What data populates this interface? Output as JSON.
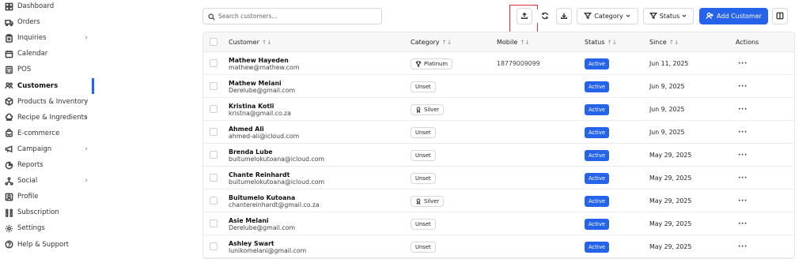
{
  "sidebar": {
    "items": [
      {
        "label": "Dashboard",
        "icon": "dashboard-icon",
        "chevron": false
      },
      {
        "label": "Orders",
        "icon": "truck-icon",
        "chevron": false
      },
      {
        "label": "Inquiries",
        "icon": "clipboard-icon",
        "chevron": true
      },
      {
        "label": "Calendar",
        "icon": "calendar-icon",
        "chevron": false
      },
      {
        "label": "POS",
        "icon": "pos-icon",
        "chevron": false
      },
      {
        "label": "Customers",
        "icon": "users-icon",
        "chevron": false,
        "active": true
      },
      {
        "label": "Products & Inventory",
        "icon": "box-icon",
        "chevron": true
      },
      {
        "label": "Recipe & Ingredients",
        "icon": "chef-hat-icon",
        "chevron": true
      },
      {
        "label": "E-commerce",
        "icon": "store-icon",
        "chevron": false
      },
      {
        "label": "Campaign",
        "icon": "megaphone-icon",
        "chevron": true
      },
      {
        "label": "Reports",
        "icon": "pie-chart-icon",
        "chevron": false
      },
      {
        "label": "Social",
        "icon": "share-icon",
        "chevron": true
      },
      {
        "label": "Profile",
        "icon": "profile-icon",
        "chevron": false
      },
      {
        "label": "Subscription",
        "icon": "subscription-icon",
        "chevron": false
      },
      {
        "label": "Settings",
        "icon": "gear-icon",
        "chevron": false
      },
      {
        "label": "Help & Support",
        "icon": "help-icon",
        "chevron": false
      }
    ],
    "chevron": "›"
  },
  "toolbar": {
    "search_placeholder": "Search customers...",
    "category_label": "Category",
    "status_label": "Status",
    "add_label": "Add Customer"
  },
  "table": {
    "headers": {
      "customer": "Customer",
      "category": "Category",
      "mobile": "Mobile",
      "status": "Status",
      "since": "Since",
      "actions": "Actions"
    },
    "sort_glyph": "↑↓",
    "more_glyph": "···",
    "rows": [
      {
        "name": "Mathew Hayeden",
        "email": "mathew@mathew.com",
        "category": "Platinum",
        "category_icon": "trophy-icon",
        "mobile": "18779009099",
        "status": "Active",
        "since": "Jun 11, 2025"
      },
      {
        "name": "Mathew Melani",
        "email": "Derelube@gmail.com",
        "category": "Unset",
        "category_icon": "",
        "mobile": "",
        "status": "Active",
        "since": "Jun 9, 2025"
      },
      {
        "name": "Kristina Kotli",
        "email": "kristna@gmail.co.za",
        "category": "Silver",
        "category_icon": "medal-icon",
        "mobile": "",
        "status": "Active",
        "since": "Jun 9, 2025"
      },
      {
        "name": "Ahmed Ali",
        "email": "ahmed-ali@icloud.com",
        "category": "Unset",
        "category_icon": "",
        "mobile": "",
        "status": "Active",
        "since": "Jun 9, 2025"
      },
      {
        "name": "Brenda Lube",
        "email": "buitumelokutoana@icloud.com",
        "category": "Unset",
        "category_icon": "",
        "mobile": "",
        "status": "Active",
        "since": "May 29, 2025"
      },
      {
        "name": "Chante Reinhardt",
        "email": "buitumelokutoana@icloud.com",
        "category": "Unset",
        "category_icon": "",
        "mobile": "",
        "status": "Active",
        "since": "May 29, 2025"
      },
      {
        "name": "Buitumelo Kutoana",
        "email": "chantereinhardt@gmail.co.za",
        "category": "Silver",
        "category_icon": "medal-icon",
        "mobile": "",
        "status": "Active",
        "since": "May 29, 2025"
      },
      {
        "name": "Asie Melani",
        "email": "Derelube@gmail.com",
        "category": "Unset",
        "category_icon": "",
        "mobile": "",
        "status": "Active",
        "since": "May 29, 2025"
      },
      {
        "name": "Ashley Swart",
        "email": "lunikomelani@gmail.com",
        "category": "Unset",
        "category_icon": "",
        "mobile": "",
        "status": "Active",
        "since": "May 29, 2025"
      }
    ]
  },
  "colors": {
    "accent": "#2563eb",
    "highlight": "#e03030"
  }
}
